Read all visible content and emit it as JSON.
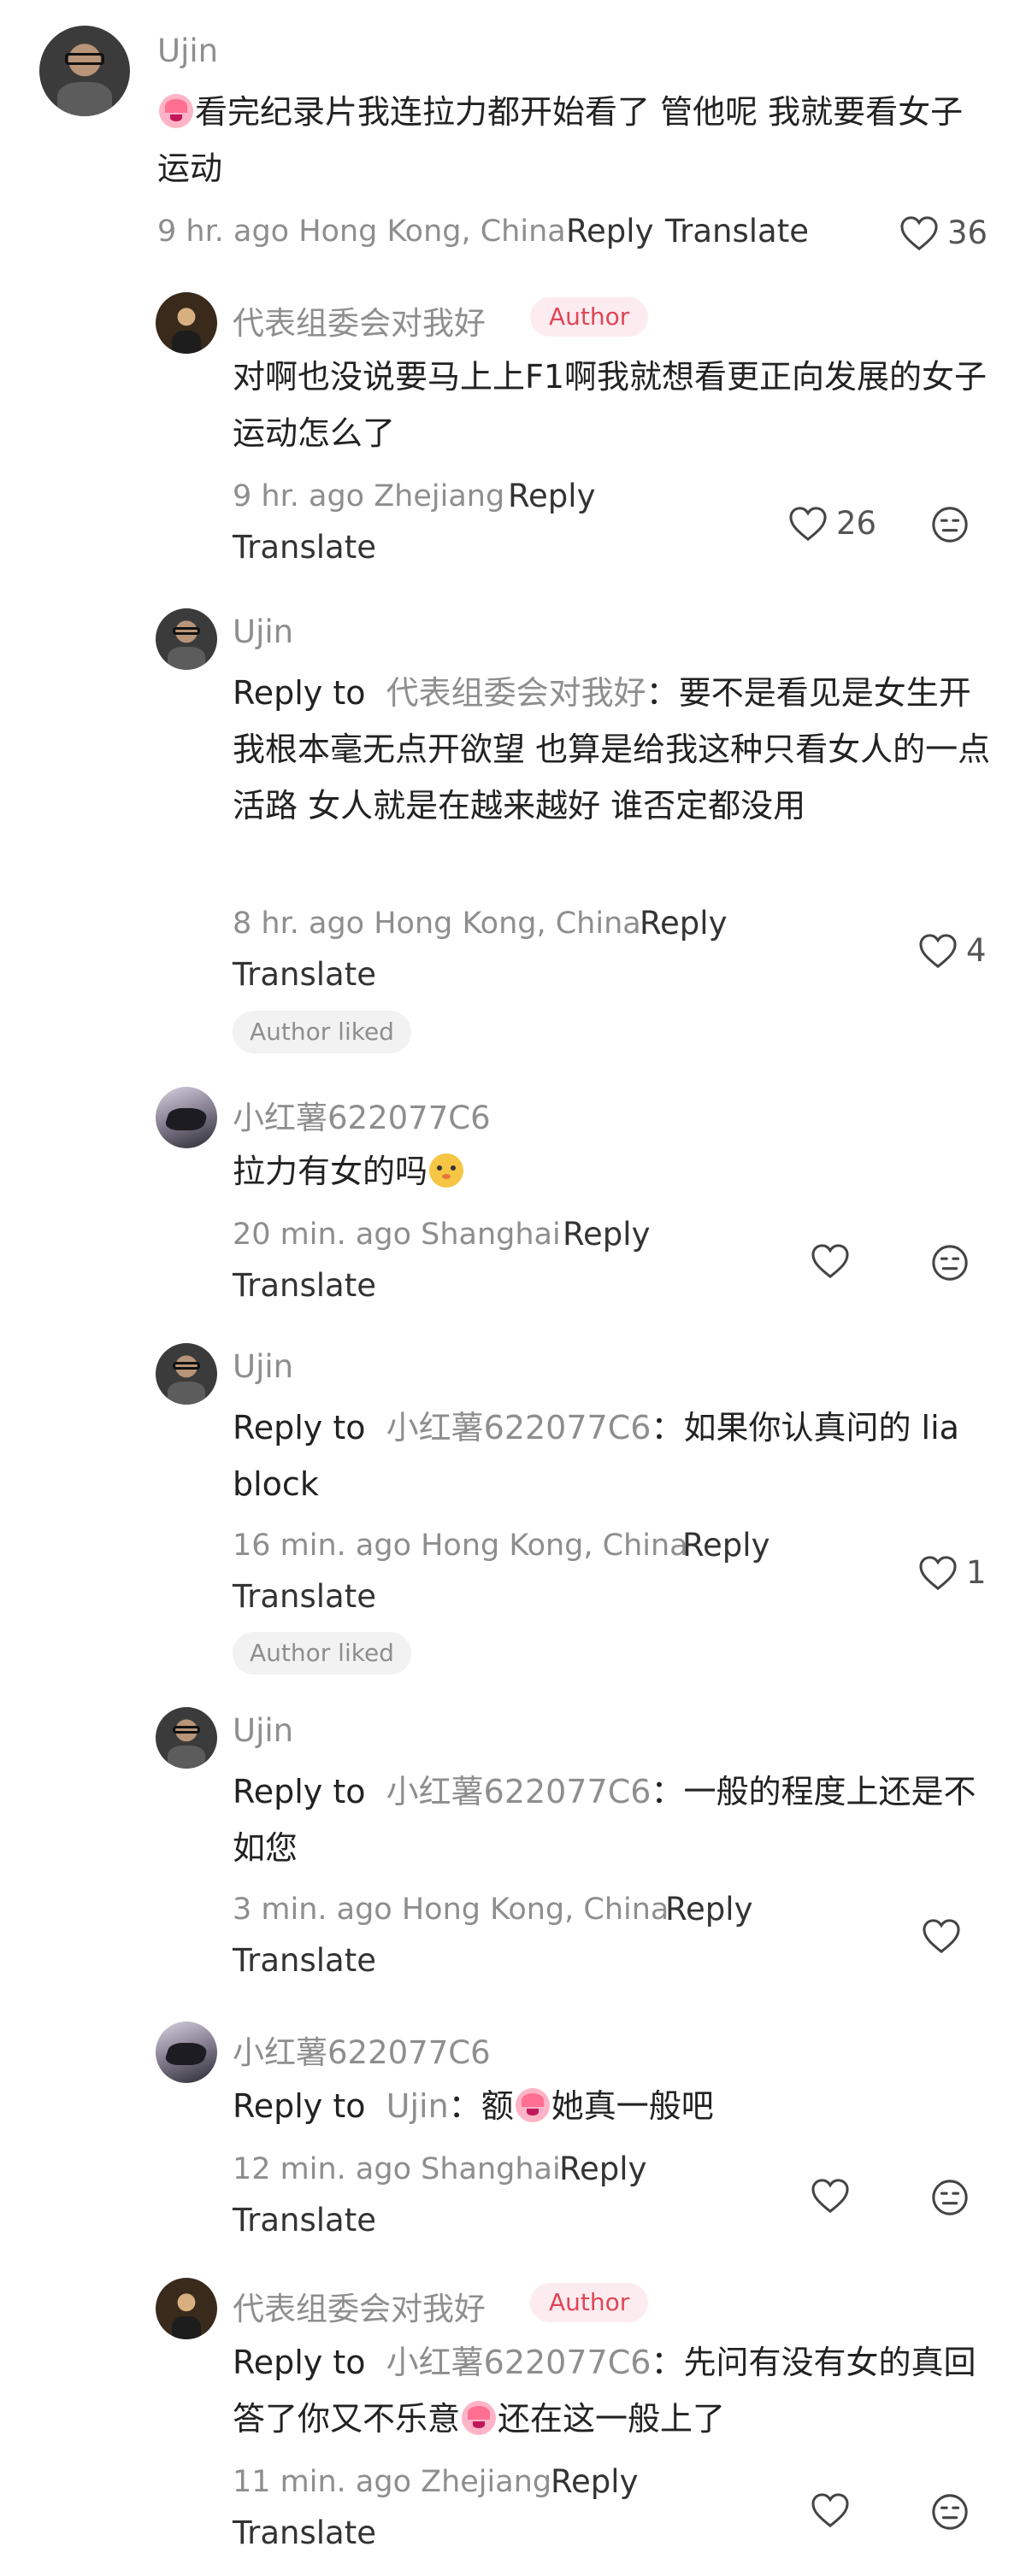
{
  "comments": [
    {
      "author": "Ujin",
      "text": "看完纪录片我连拉力都开始看了 管他呢 我就要看女子运动",
      "meta": "9 hr. ago Hong Kong, China",
      "reply_label": "Reply",
      "translate_label": "Translate",
      "likes": "36"
    },
    {
      "author": "代表组委会对我好",
      "badge": "Author",
      "text": "对啊也没说要马上上F1啊我就想看更正向发展的女子运动怎么了",
      "meta": "9 hr. ago Zhejiang",
      "reply_label": "Reply",
      "translate_label": "Translate",
      "likes": "26"
    },
    {
      "author": "Ujin",
      "reply_prefix": "Reply to",
      "reply_target": "代表组委会对我好",
      "text": "要不是看见是女生开我根本毫无点开欲望 也算是给我这种只看女人的一点活路 女人就是在越来越好 谁否定都没用",
      "meta": "8 hr. ago Hong Kong, China",
      "reply_label": "Reply",
      "translate_label": "Translate",
      "likes": "4",
      "author_liked": "Author liked"
    },
    {
      "author": "小红薯622077C6",
      "text": "拉力有女的吗",
      "meta": "20 min. ago Shanghai",
      "reply_label": "Reply",
      "translate_label": "Translate"
    },
    {
      "author": "Ujin",
      "reply_prefix": "Reply to",
      "reply_target": "小红薯622077C6",
      "text": "如果你认真问的 lia block",
      "meta": "16 min. ago Hong Kong, China",
      "reply_label": "Reply",
      "translate_label": "Translate",
      "likes": "1",
      "author_liked": "Author liked"
    },
    {
      "author": "Ujin",
      "reply_prefix": "Reply to",
      "reply_target": "小红薯622077C6",
      "text": "一般的程度上还是不如您",
      "meta": "3 min. ago Hong Kong, China",
      "reply_label": "Reply",
      "translate_label": "Translate"
    },
    {
      "author": "小红薯622077C6",
      "reply_prefix": "Reply to",
      "reply_target": "Ujin",
      "text_a": "额",
      "text_b": "她真一般吧",
      "meta": "12 min. ago Shanghai",
      "reply_label": "Reply",
      "translate_label": "Translate"
    },
    {
      "author": "代表组委会对我好",
      "badge": "Author",
      "reply_prefix": "Reply to",
      "reply_target": "小红薯622077C6",
      "text_a": "先问有没有女的真回答了你又不乐意",
      "text_b": "还在这一般上了",
      "meta": "11 min. ago Zhejiang",
      "reply_label": "Reply",
      "translate_label": "Translate"
    }
  ],
  "colors": {
    "badge_bg": "#fdecef",
    "badge_text": "#e04558",
    "muted": "#8e8e8e"
  }
}
